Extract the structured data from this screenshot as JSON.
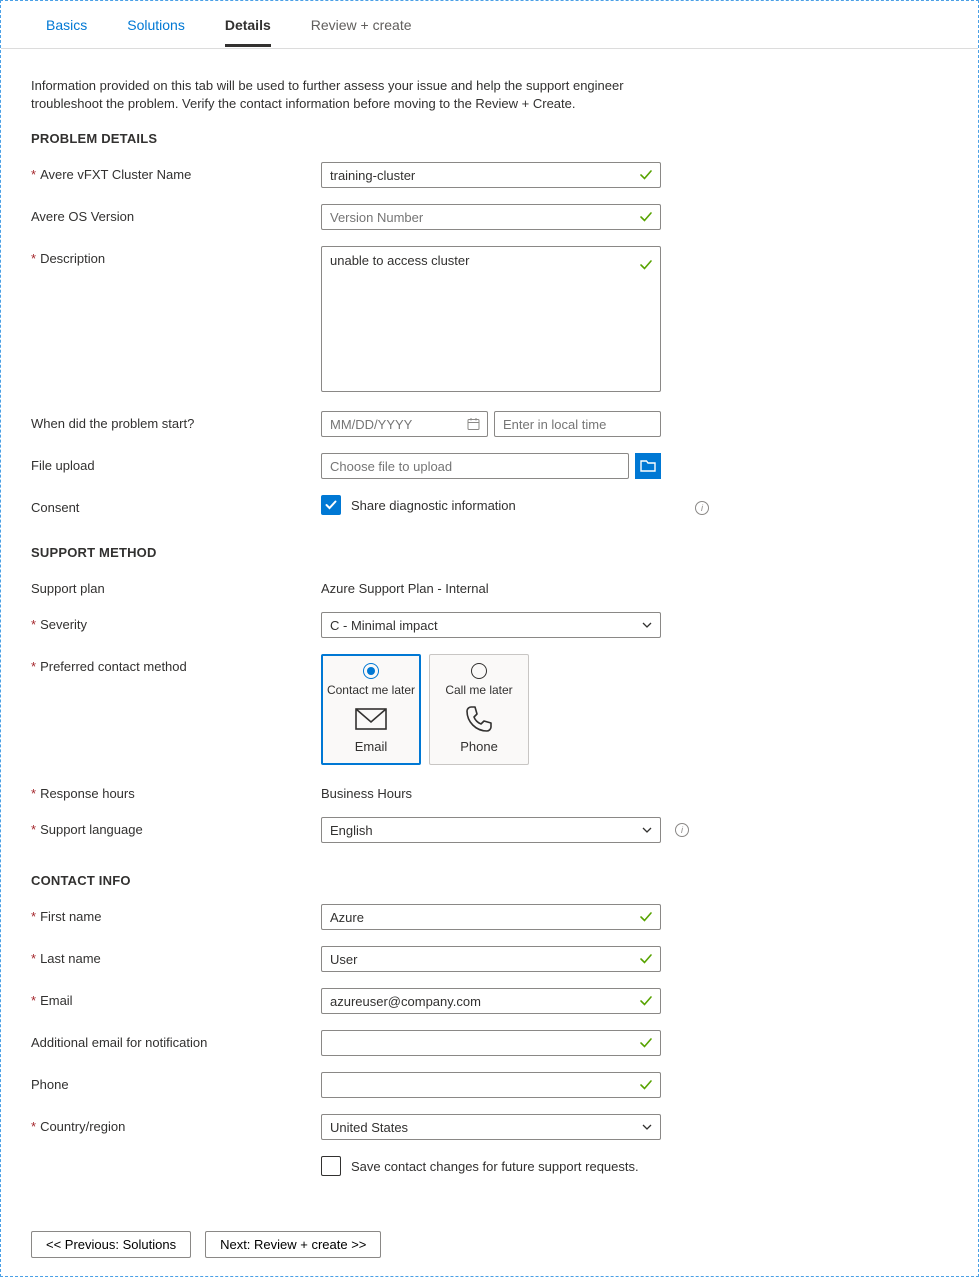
{
  "tabs": {
    "basics": "Basics",
    "solutions": "Solutions",
    "details": "Details",
    "review": "Review + create"
  },
  "intro": "Information provided on this tab will be used to further assess your issue and help the support engineer troubleshoot the problem. Verify the contact information before moving to the Review + Create.",
  "sections": {
    "problem": "PROBLEM DETAILS",
    "support": "SUPPORT METHOD",
    "contact": "CONTACT INFO"
  },
  "problem": {
    "cluster_label": "Avere vFXT Cluster Name",
    "cluster_value": "training-cluster",
    "os_label": "Avere OS Version",
    "os_placeholder": "Version Number",
    "desc_label": "Description",
    "desc_value": "unable to access cluster",
    "when_label": "When did the problem start?",
    "date_placeholder": "MM/DD/YYYY",
    "time_placeholder": "Enter in local time",
    "file_label": "File upload",
    "file_placeholder": "Choose file to upload",
    "consent_label": "Consent",
    "consent_text": "Share diagnostic information"
  },
  "support": {
    "plan_label": "Support plan",
    "plan_value": "Azure Support Plan - Internal",
    "severity_label": "Severity",
    "severity_value": "C - Minimal impact",
    "contact_method_label": "Preferred contact method",
    "email_card_title": "Contact me later",
    "email_card_sub": "Email",
    "phone_card_title": "Call me later",
    "phone_card_sub": "Phone",
    "hours_label": "Response hours",
    "hours_value": "Business Hours",
    "lang_label": "Support language",
    "lang_value": "English"
  },
  "contact": {
    "first_label": "First name",
    "first_value": "Azure",
    "last_label": "Last name",
    "last_value": "User",
    "email_label": "Email",
    "email_value": "azureuser@company.com",
    "addemail_label": "Additional email for notification",
    "addemail_value": "",
    "phone_label": "Phone",
    "phone_value": "",
    "country_label": "Country/region",
    "country_value": "United States",
    "save_text": "Save contact changes for future support requests."
  },
  "footer": {
    "prev": "<< Previous: Solutions",
    "next": "Next: Review + create >>"
  }
}
